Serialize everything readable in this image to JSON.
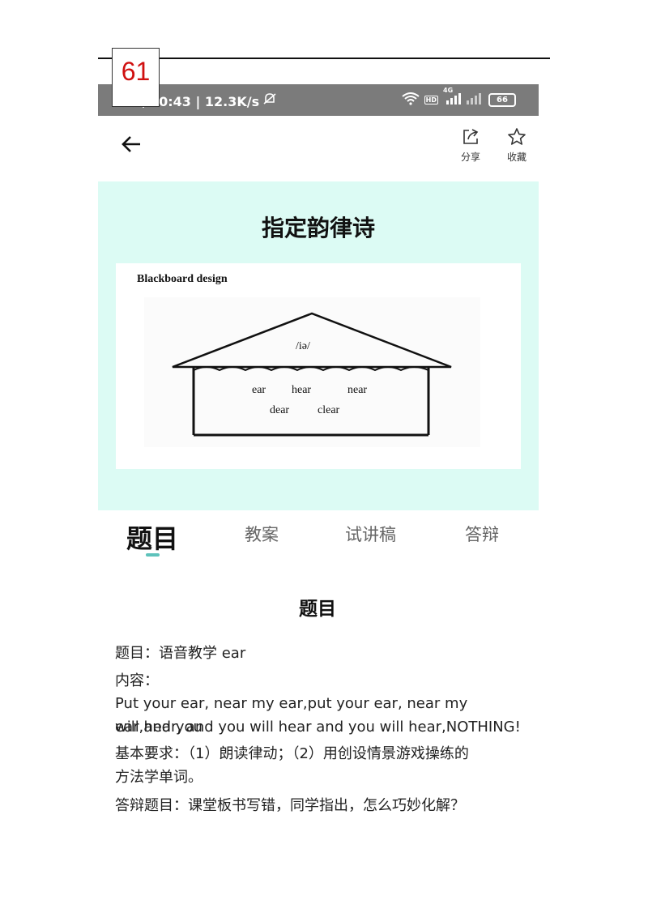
{
  "status_bar": {
    "time_speed": "上午10:43 | 12.3K/s",
    "icons": [
      "mute-bell-icon",
      "wifi-icon",
      "hd-icon",
      "signal-4g-icon",
      "signal-icon"
    ],
    "hd": "HD",
    "network": "4G",
    "battery": "66"
  },
  "header": {
    "page_number": "61",
    "share_label": "分享",
    "favorite_label": "收藏"
  },
  "banner": {
    "title": "指定韵律诗",
    "board": {
      "caption": "Blackboard design",
      "phoneme": "/iə/",
      "row1": [
        "ear",
        "hear",
        "near"
      ],
      "row2": [
        "dear",
        "clear"
      ]
    }
  },
  "tabs": [
    {
      "label": "题目",
      "active": true
    },
    {
      "label": "教案",
      "active": false
    },
    {
      "label": "试讲稿",
      "active": false
    },
    {
      "label": "答辩",
      "active": false
    }
  ],
  "content": {
    "section_title": "题目",
    "topic": "题目：语音教学 ear",
    "content_label": "内容：",
    "content_line1": "Put your ear, near my ear,put your ear, near my ear,and you",
    "content_line2": "will hear, and you will hear and you will hear,NOTHING!",
    "requirements_line1": "基本要求：（1）朗读律动；（2）用创设情景游戏操练的",
    "requirements_line2": "方法学单词。",
    "defense": "答辩题目：课堂板书写错，同学指出，怎么巧妙化解？"
  },
  "colors": {
    "status_bar": "#7b7b7b",
    "banner_bg": "#dcfbf4",
    "tab_indicator": "#5ec2bb",
    "page_number": "#d01010"
  }
}
